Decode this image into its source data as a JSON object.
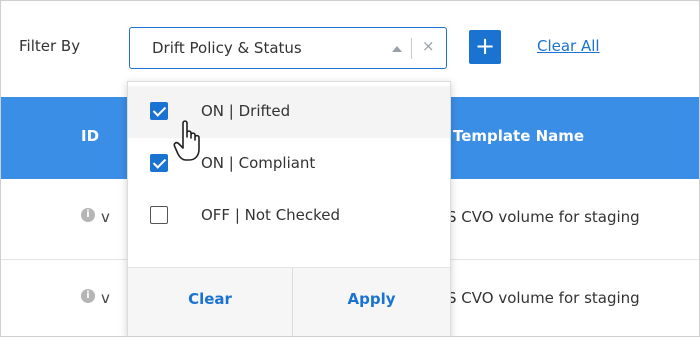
{
  "filter_bar": {
    "label": "Filter By",
    "select_value": "Drift Policy & Status",
    "clear_symbol": "×",
    "add_label": "+",
    "clear_all": "Clear All"
  },
  "table": {
    "columns": [
      "ID",
      "Template Name"
    ],
    "rows": [
      {
        "id": "v",
        "template": "S CVO volume for staging"
      },
      {
        "id": "v",
        "template": "S CVO volume for staging"
      }
    ]
  },
  "dropdown": {
    "options": [
      {
        "label": "ON  |  Drifted",
        "checked": true
      },
      {
        "label": "ON  |  Compliant",
        "checked": true
      },
      {
        "label": "OFF  |  Not Checked",
        "checked": false
      }
    ],
    "clear_label": "Clear",
    "apply_label": "Apply"
  },
  "colors": {
    "accent": "#1a73d0",
    "header_bg": "#3b8ee6"
  },
  "icons": [
    "chevron-up-icon",
    "clear-icon",
    "plus-icon",
    "info-icon",
    "hand-cursor-icon",
    "checkbox-icon"
  ]
}
